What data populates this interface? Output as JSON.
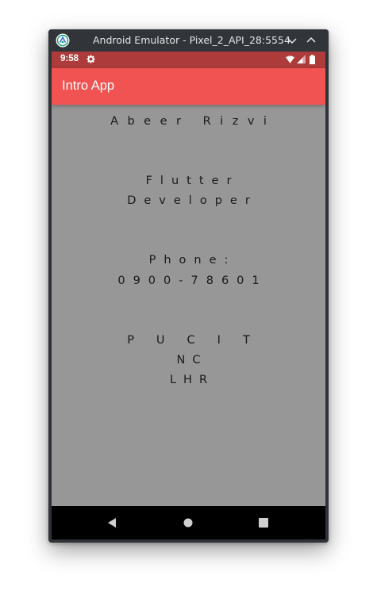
{
  "window": {
    "title": "Android Emulator - Pixel_2_API_28:5554",
    "minimize_icon": "chevron-down-icon",
    "maximize_icon": "chevron-up-icon",
    "logo_icon": "android-emulator-logo"
  },
  "status_bar": {
    "time": "9:58",
    "icons": [
      "gear-icon",
      "wifi-icon",
      "signal-icon",
      "battery-icon"
    ],
    "color": "#ad3b3b"
  },
  "app_bar": {
    "title": "Intro App",
    "color": "#f15352"
  },
  "content": {
    "background": "#979797",
    "name": "Abeer Rizvi",
    "role_line1": "Flutter",
    "role_line2": "Developer",
    "phone_label": "Phone:",
    "phone_number": "0900-78601",
    "university_line1": "PUCIT",
    "university_line2": "NC",
    "university_line3": "LHR"
  },
  "nav_bar": {
    "buttons": [
      "back-icon",
      "home-icon",
      "recents-icon"
    ]
  }
}
